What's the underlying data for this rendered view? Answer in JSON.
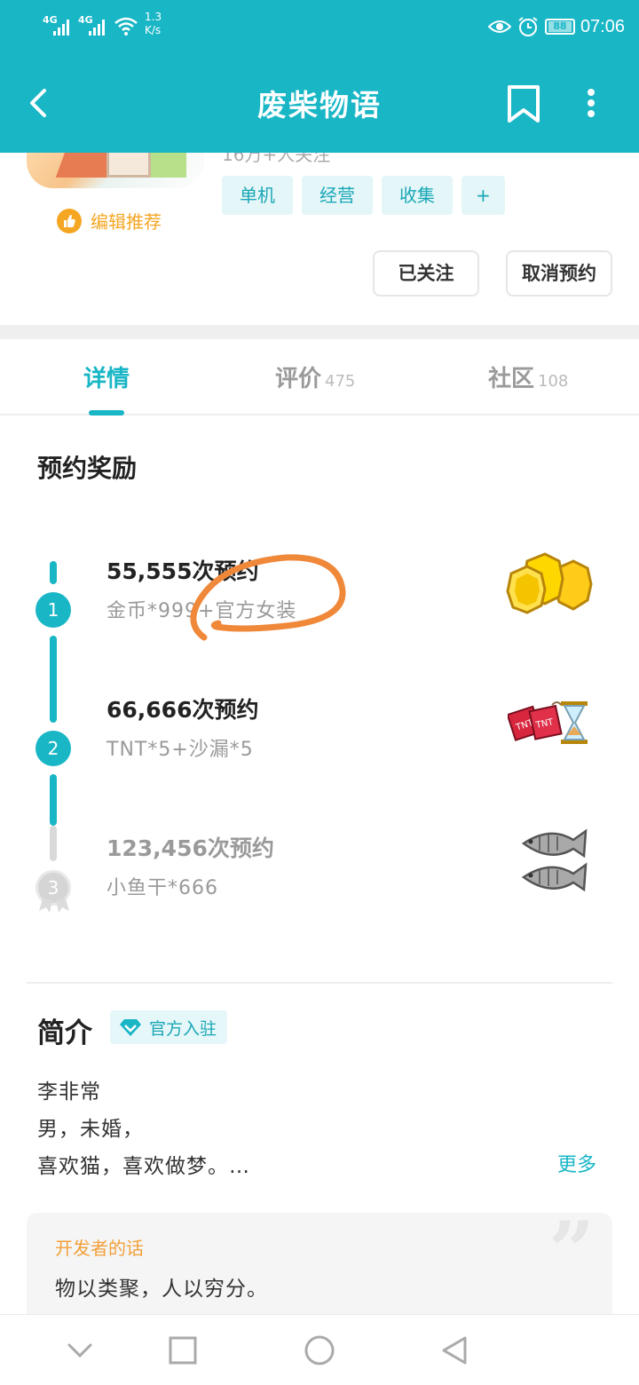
{
  "status_bar": {
    "signal_1": "4G",
    "signal_2": "4G",
    "speed_value": "1.3",
    "speed_unit": "K/s",
    "battery": "88",
    "time": "07:06"
  },
  "header": {
    "title": "废柴物语"
  },
  "game": {
    "followers_text": "16万+人关注",
    "tags": [
      "单机",
      "经营",
      "收集",
      "+"
    ],
    "editor_badge": "编辑推荐",
    "follow_button": "已关注",
    "cancel_reserve_button": "取消预约"
  },
  "tabs": [
    {
      "label": "详情",
      "count": ""
    },
    {
      "label": "评价",
      "count": "475"
    },
    {
      "label": "社区",
      "count": "108"
    }
  ],
  "rewards": {
    "section_title": "预约奖励",
    "items": [
      {
        "step": "1",
        "title": "55,555次预约",
        "desc": "金币*999+官方女装",
        "icon": "gold-coins",
        "reached": true
      },
      {
        "step": "2",
        "title": "66,666次预约",
        "desc": "TNT*5+沙漏*5",
        "icon": "tnt-hourglass",
        "reached": true
      },
      {
        "step": "3",
        "title": "123,456次预约",
        "desc": "小鱼干*666",
        "icon": "dried-fish",
        "reached": false
      }
    ]
  },
  "intro": {
    "title": "简介",
    "official_badge": "官方入驻",
    "lines": [
      "李非常",
      "男，未婚，",
      "喜欢猫，喜欢做梦。…"
    ],
    "more_link": "更多"
  },
  "developer": {
    "label": "开发者的话",
    "text": "物以类聚，人以穷分。"
  },
  "colors": {
    "brand": "#19b6c6",
    "accent_orange": "#f5a623",
    "annotation_orange": "#f0883a"
  }
}
